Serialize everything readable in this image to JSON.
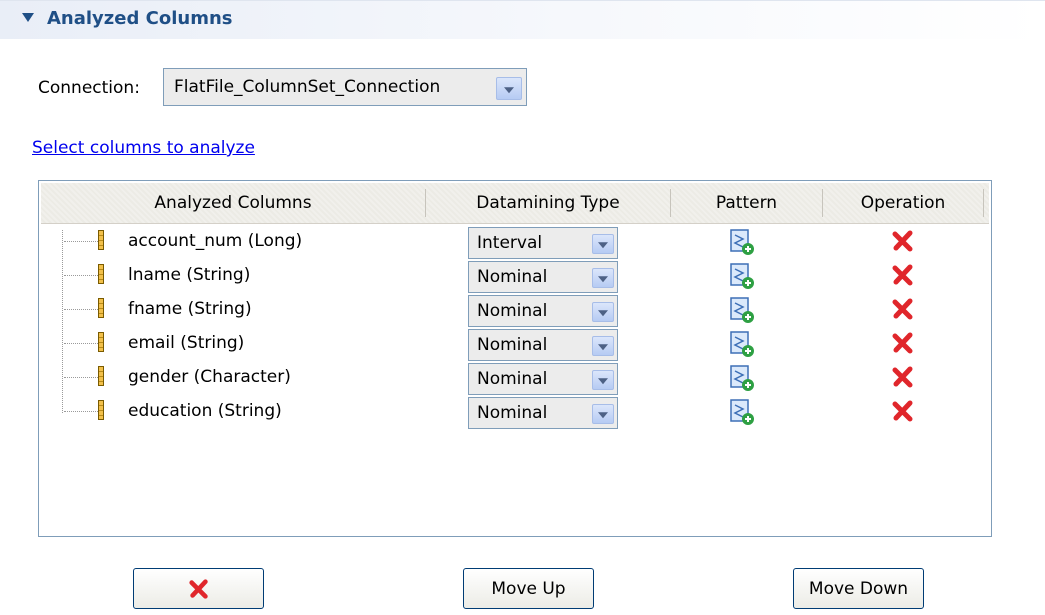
{
  "section": {
    "title": "Analyzed Columns"
  },
  "connection": {
    "label": "Connection:",
    "value": "FlatFile_ColumnSet_Connection"
  },
  "select_link": "Select columns to analyze",
  "table": {
    "headers": [
      "Analyzed Columns",
      "Datamining Type",
      "Pattern",
      "Operation"
    ],
    "rows": [
      {
        "column": "account_num (Long)",
        "datamining_type": "Interval"
      },
      {
        "column": "lname (String)",
        "datamining_type": "Nominal"
      },
      {
        "column": "fname (String)",
        "datamining_type": "Nominal"
      },
      {
        "column": "email (String)",
        "datamining_type": "Nominal"
      },
      {
        "column": "gender (Character)",
        "datamining_type": "Nominal"
      },
      {
        "column": "education (String)",
        "datamining_type": "Nominal"
      }
    ]
  },
  "buttons": {
    "delete_icon": "red-x-icon",
    "move_up": "Move Up",
    "move_down": "Move Down"
  },
  "colors": {
    "title_blue": "#1f4f86",
    "link_blue": "#0000ee",
    "delete_red": "#e0262b"
  },
  "icons": {
    "column": "column-icon",
    "pattern": "add-pattern-icon",
    "delete": "delete-icon"
  }
}
